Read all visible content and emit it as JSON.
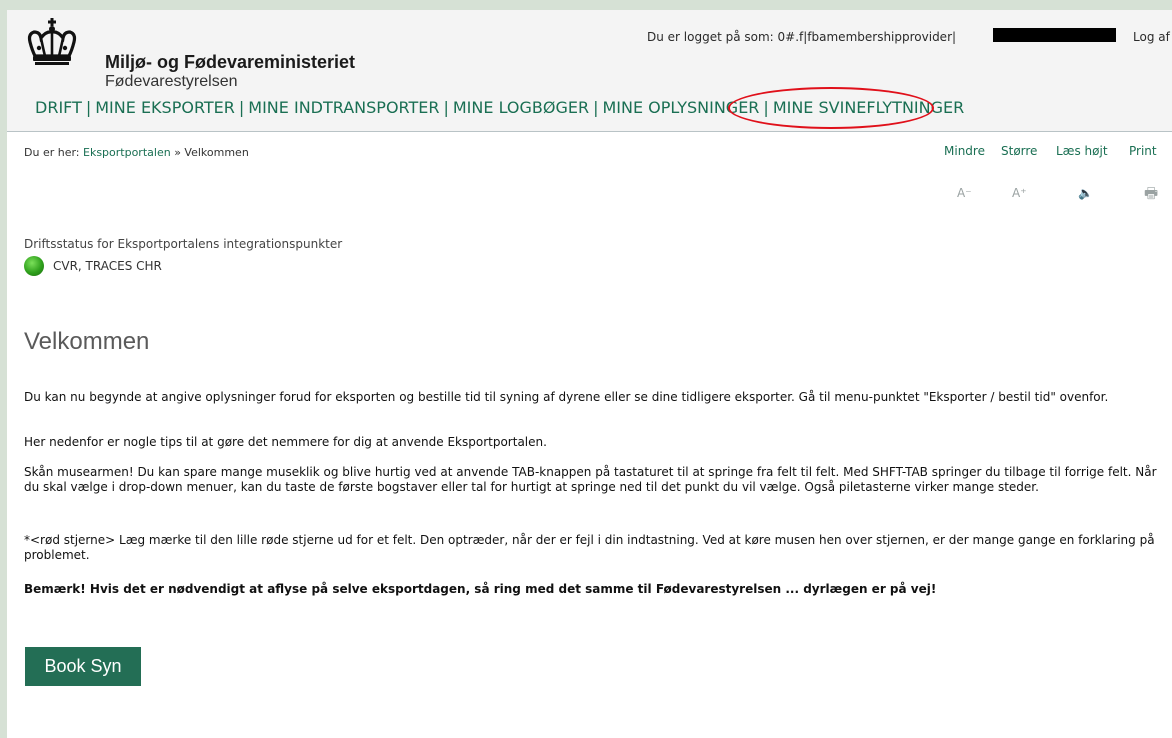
{
  "header": {
    "org_name": "Miljø- og Fødevareministeriet",
    "agency_name": "Fødevarestyrelsen",
    "login_text": "Du er logget på som: 0#.f|fbamembershipprovider|",
    "logout_label": "Log af"
  },
  "nav": {
    "items": [
      "DRIFT",
      "MINE EKSPORTER",
      "MINE INDTRANSPORTER",
      "MINE LOGBØGER",
      "MINE OPLYSNINGER",
      "MINE SVINEFLYTNINGER"
    ],
    "separator": "|"
  },
  "breadcrumb": {
    "prefix": "Du er her:",
    "link": "Eksportportalen",
    "separator": "»",
    "current": "Velkommen"
  },
  "tools": {
    "smaller": "Mindre",
    "larger": "Større",
    "read_aloud": "Læs højt",
    "print": "Print",
    "icons": {
      "smaller": "A⁻",
      "larger": "A⁺",
      "read_aloud": "🔈",
      "print": "🖶"
    }
  },
  "status": {
    "title": "Driftsstatus for Eksportportalens integrationspunkter",
    "systems": "CVR, TRACES  CHR",
    "color": "#2fa01c"
  },
  "main": {
    "title": "Velkommen",
    "paragraphs": [
      "Du kan nu begynde at angive oplysninger forud for eksporten og bestille tid til syning af dyrene eller se dine tidligere eksporter. Gå til menu-punktet \"Eksporter / bestil tid\" ovenfor.",
      "Her nedenfor er nogle tips til at gøre det nemmere for dig at anvende Eksportportalen.",
      "Skån musearmen! Du kan spare mange museklik og blive hurtig ved at anvende TAB-knappen på tastaturet til at springe fra felt til felt. Med SHFT-TAB springer du tilbage til forrige felt. Når du skal vælge i drop-down menuer, kan du taste de første bogstaver eller tal for hurtigt at springe ned til det punkt du vil vælge. Også piletasterne virker mange steder.",
      "*<rød stjerne> Læg mærke til den lille røde stjerne ud for et felt. Den optræder, når der er fejl i din indtastning. Ved at køre musen hen over stjernen, er der mange gange en forklaring på problemet.",
      "Bemærk! Hvis det er nødvendigt at aflyse på selve eksportdagen, så ring med det samme til Fødevarestyrelsen ... dyrlægen er på vej!"
    ],
    "book_button": "Book Syn"
  },
  "colors": {
    "brand_green": "#236e55",
    "nav_green": "#1a6f53",
    "highlight_red": "#e0101a"
  }
}
